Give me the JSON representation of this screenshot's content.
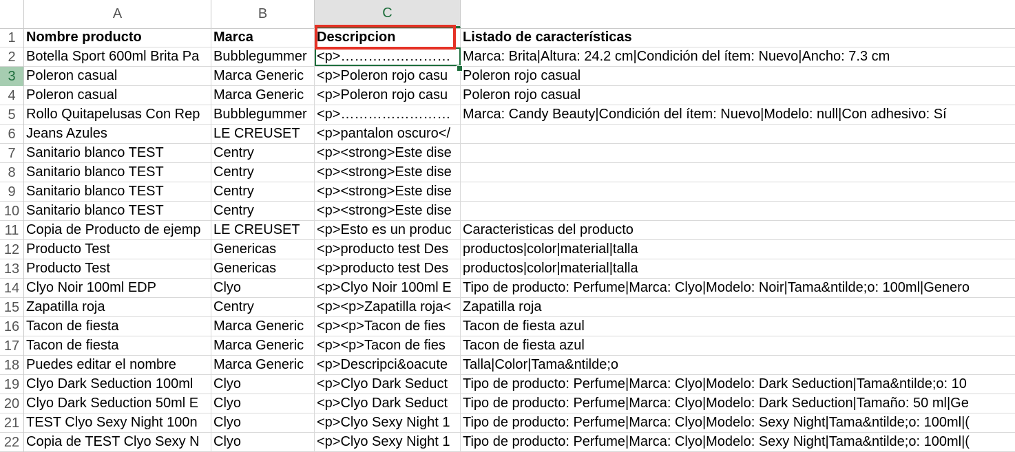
{
  "columns": [
    "A",
    "B",
    "C"
  ],
  "active_column": "C",
  "active_row": "3",
  "rows": [
    {
      "n": "1",
      "a": "Nombre producto",
      "b": "Marca",
      "c": "Descripcion",
      "d": "Listado de características"
    },
    {
      "n": "2",
      "a": "Botella Sport 600ml Brita Pa",
      "b": "Bubblegummer",
      "c": "<p>……………………",
      "d": "Marca: Brita|Altura: 24.2 cm|Condición del ítem: Nuevo|Ancho: 7.3 cm"
    },
    {
      "n": "3",
      "a": "Poleron casual",
      "b": "Marca Generic",
      "c": "<p>Poleron rojo casu",
      "d": "Poleron rojo casual"
    },
    {
      "n": "4",
      "a": "Poleron casual",
      "b": "Marca Generic",
      "c": "<p>Poleron rojo casu",
      "d": "Poleron rojo casual"
    },
    {
      "n": "5",
      "a": "Rollo Quitapelusas Con Rep",
      "b": "Bubblegummer",
      "c": "<p>……………………",
      "d": "Marca: Candy Beauty|Condición del ítem: Nuevo|Modelo: null|Con adhesivo: Sí"
    },
    {
      "n": "6",
      "a": "Jeans Azules",
      "b": " LE CREUSET",
      "c": "<p>pantalon oscuro</",
      "d": ""
    },
    {
      "n": "7",
      "a": "Sanitario blanco TEST",
      "b": "Centry",
      "c": "<p><strong>Este dise",
      "d": ""
    },
    {
      "n": "8",
      "a": "Sanitario blanco TEST",
      "b": "Centry",
      "c": "<p><strong>Este dise",
      "d": ""
    },
    {
      "n": "9",
      "a": "Sanitario blanco TEST",
      "b": "Centry",
      "c": "<p><strong>Este dise",
      "d": ""
    },
    {
      "n": "10",
      "a": "Sanitario blanco TEST",
      "b": "Centry",
      "c": "<p><strong>Este dise",
      "d": ""
    },
    {
      "n": "11",
      "a": "Copia de Producto de ejemp",
      "b": " LE CREUSET",
      "c": "<p>Esto es un produc",
      "d": "Caracteristicas del producto"
    },
    {
      "n": "12",
      "a": "Producto Test",
      "b": "Genericas",
      "c": "<p>producto test Des",
      "d": "productos|color|material|talla"
    },
    {
      "n": "13",
      "a": "Producto Test",
      "b": "Genericas",
      "c": "<p>producto test Des",
      "d": "productos|color|material|talla"
    },
    {
      "n": "14",
      "a": "Clyo Noir 100ml EDP",
      "b": "Clyo",
      "c": "<p>Clyo Noir 100ml E",
      "d": "Tipo de producto: Perfume|Marca: Clyo|Modelo: Noir|Tama&ntilde;o: 100ml|Genero"
    },
    {
      "n": "15",
      "a": "Zapatilla roja",
      "b": "Centry",
      "c": "<p><p>Zapatilla roja<",
      "d": "Zapatilla roja"
    },
    {
      "n": "16",
      "a": "Tacon de fiesta",
      "b": "Marca Generic",
      "c": "<p><p>Tacon de fies",
      "d": "Tacon de fiesta azul"
    },
    {
      "n": "17",
      "a": "Tacon de fiesta",
      "b": "Marca Generic",
      "c": "<p><p>Tacon de fies",
      "d": "Tacon de fiesta azul"
    },
    {
      "n": "18",
      "a": "Puedes editar el nombre",
      "b": "Marca Generic",
      "c": "<p>Descripci&oacute",
      "d": "Talla|Color|Tama&ntilde;o"
    },
    {
      "n": "19",
      "a": "Clyo Dark Seduction 100ml",
      "b": "Clyo",
      "c": "<p>Clyo Dark Seduct",
      "d": "Tipo de producto: Perfume|Marca: Clyo|Modelo: Dark Seduction|Tama&ntilde;o: 10"
    },
    {
      "n": "20",
      "a": "Clyo Dark Seduction 50ml E",
      "b": "Clyo",
      "c": "<p>Clyo Dark Seduct",
      "d": "Tipo de producto: Perfume|Marca: Clyo|Modelo: Dark Seduction|Tamaño: 50 ml|Ge"
    },
    {
      "n": "21",
      "a": "TEST Clyo Sexy Night 100n",
      "b": "Clyo",
      "c": "<p>Clyo Sexy Night 1",
      "d": "Tipo de producto: Perfume|Marca: Clyo|Modelo: Sexy Night|Tama&ntilde;o: 100ml|("
    },
    {
      "n": "22",
      "a": "Copia de TEST Clyo Sexy N",
      "b": "Clyo",
      "c": "<p>Clyo Sexy Night 1",
      "d": "Tipo de producto: Perfume|Marca: Clyo|Modelo: Sexy Night|Tama&ntilde;o: 100ml|("
    }
  ]
}
